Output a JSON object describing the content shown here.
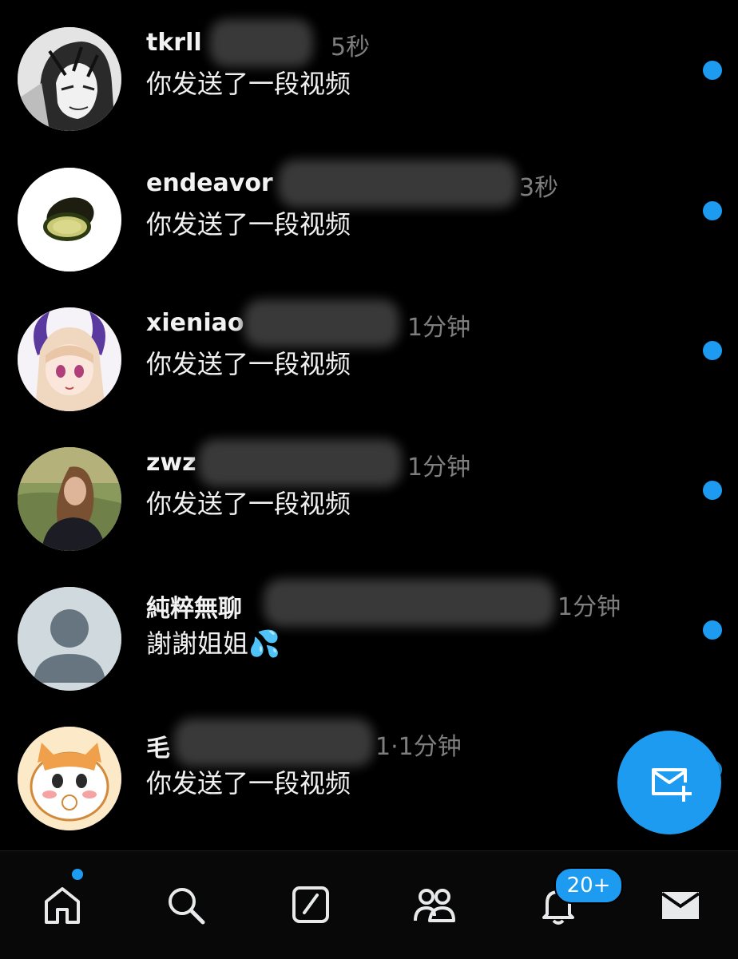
{
  "conversations": [
    {
      "name": "tkrll",
      "time": "5秒",
      "message": "你发送了一段视频",
      "unread": true,
      "avatar_icon": "manga-character-avatar"
    },
    {
      "name": "endeavor",
      "time": "3秒",
      "message": "你发送了一段视频",
      "unread": true,
      "avatar_icon": "avocado-avatar"
    },
    {
      "name": "xieniao",
      "time": "1分钟",
      "message": "你发送了一段视频",
      "unread": true,
      "avatar_icon": "anime-girl-avatar"
    },
    {
      "name": "zwz",
      "time": "1分钟",
      "message": "你发送了一段视频",
      "unread": true,
      "avatar_icon": "photo-person-avatar"
    },
    {
      "name": "純粹無聊",
      "time": "1分钟",
      "message": "謝謝姐姐💦",
      "unread": true,
      "avatar_icon": "default-person-avatar"
    },
    {
      "name": "毛",
      "time": "1·1分钟",
      "message": "你发送了一段视频",
      "unread": true,
      "avatar_icon": "cartoon-cat-avatar"
    }
  ],
  "fab": {
    "icon": "new-message-icon"
  },
  "tabbar": {
    "items": [
      {
        "id": "home",
        "icon": "home-icon",
        "has_dot": true
      },
      {
        "id": "search",
        "icon": "search-icon"
      },
      {
        "id": "compose",
        "icon": "compose-square-icon"
      },
      {
        "id": "communities",
        "icon": "people-icon"
      },
      {
        "id": "notifications",
        "icon": "bell-icon",
        "badge": "20+"
      },
      {
        "id": "messages",
        "icon": "envelope-icon"
      }
    ]
  },
  "colors": {
    "accent": "#1d9bf0",
    "background": "#000000",
    "muted_text": "#7e7e7e"
  }
}
